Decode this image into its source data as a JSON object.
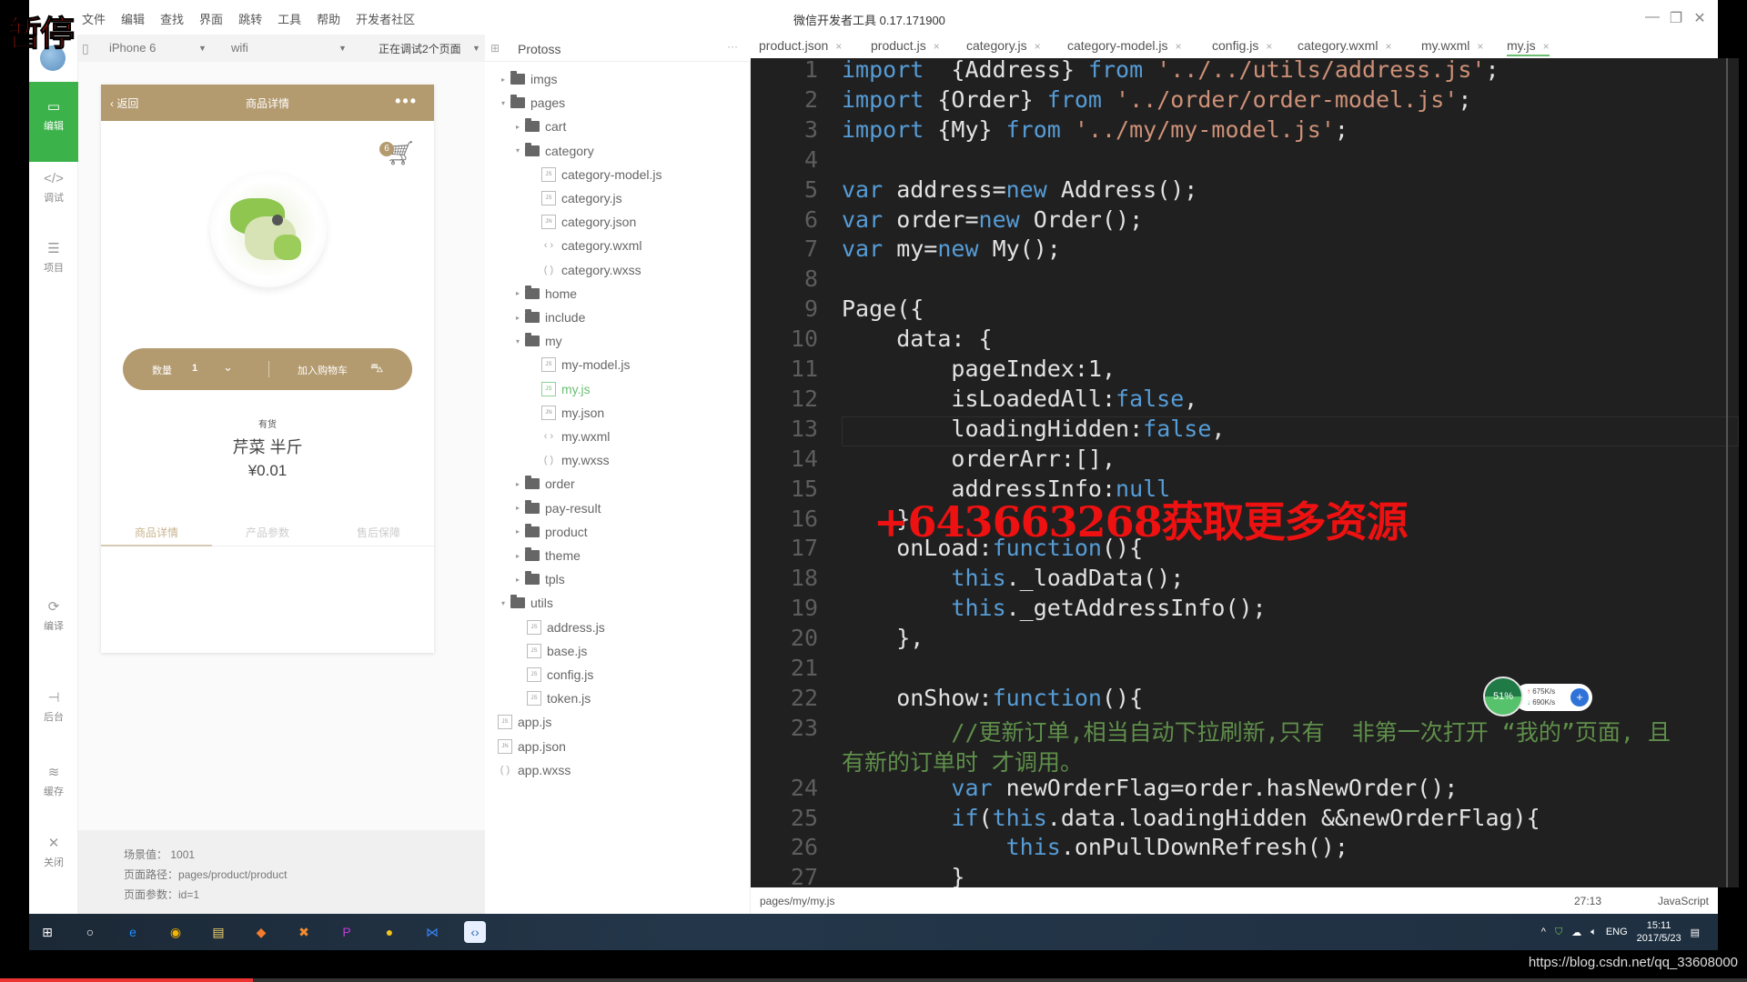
{
  "overlay": {
    "pause_label": "暂停",
    "watermark": "+643663268获取更多资源",
    "blog_url": "https://blog.csdn.net/qq_33608000",
    "video_progress": 0.145
  },
  "window": {
    "title": "微信开发者工具 0.17.171900",
    "menu": [
      "文件",
      "编辑",
      "查找",
      "界面",
      "跳转",
      "工具",
      "帮助",
      "开发者社区"
    ],
    "controls": {
      "minimize": "—",
      "maximize": "❐",
      "close": "✕"
    }
  },
  "sidebar": {
    "items": [
      {
        "label": "编辑",
        "icon": "editor-icon",
        "glyph": "▭",
        "active": true
      },
      {
        "label": "调试",
        "icon": "code-icon",
        "glyph": "</>"
      },
      {
        "label": "项目",
        "icon": "menu-icon",
        "glyph": "☰"
      },
      {
        "label": "编译",
        "icon": "compile-icon",
        "glyph": "⟳"
      },
      {
        "label": "后台",
        "icon": "backend-icon",
        "glyph": "⊣"
      },
      {
        "label": "缓存",
        "icon": "layers-icon",
        "glyph": "≋"
      },
      {
        "label": "关闭",
        "icon": "close-icon",
        "glyph": "✕"
      }
    ]
  },
  "simulator": {
    "device": "iPhone 6",
    "network": "wifi",
    "debug_status": "正在调试2个页面",
    "phone": {
      "nav_back": "返回",
      "nav_title": "商品详情",
      "nav_more": "•••",
      "cart_count": "6",
      "quantity_label": "数量",
      "quantity_value": "1",
      "add_cart_label": "加入购物车",
      "stock": "有货",
      "product_name": "芹菜 半斤",
      "price": "¥0.01",
      "tabs": [
        "商品详情",
        "产品参数",
        "售后保障"
      ]
    },
    "info": {
      "scene_label": "场景值：",
      "scene_value": "1001",
      "path_label": "页面路径：",
      "path_value": "pages/product/product",
      "params_label": "页面参数：",
      "params_value": "id=1"
    }
  },
  "filetree": {
    "project": "Protoss",
    "nodes": [
      {
        "name": "imgs",
        "type": "folder",
        "depth": 0,
        "open": false
      },
      {
        "name": "pages",
        "type": "folder",
        "depth": 0,
        "open": true
      },
      {
        "name": "cart",
        "type": "folder",
        "depth": 1,
        "open": false
      },
      {
        "name": "category",
        "type": "folder",
        "depth": 1,
        "open": true
      },
      {
        "name": "category-model.js",
        "type": "js",
        "depth": 2
      },
      {
        "name": "category.js",
        "type": "js",
        "depth": 2
      },
      {
        "name": "category.json",
        "type": "json",
        "depth": 2
      },
      {
        "name": "category.wxml",
        "type": "wxml",
        "depth": 2
      },
      {
        "name": "category.wxss",
        "type": "wxss",
        "depth": 2
      },
      {
        "name": "home",
        "type": "folder",
        "depth": 1,
        "open": false
      },
      {
        "name": "include",
        "type": "folder",
        "depth": 1,
        "open": false
      },
      {
        "name": "my",
        "type": "folder",
        "depth": 1,
        "open": true
      },
      {
        "name": "my-model.js",
        "type": "js",
        "depth": 2
      },
      {
        "name": "my.js",
        "type": "js",
        "depth": 2,
        "selected": true
      },
      {
        "name": "my.json",
        "type": "json",
        "depth": 2
      },
      {
        "name": "my.wxml",
        "type": "wxml",
        "depth": 2
      },
      {
        "name": "my.wxss",
        "type": "wxss",
        "depth": 2
      },
      {
        "name": "order",
        "type": "folder",
        "depth": 1,
        "open": false
      },
      {
        "name": "pay-result",
        "type": "folder",
        "depth": 1,
        "open": false
      },
      {
        "name": "product",
        "type": "folder",
        "depth": 1,
        "open": false
      },
      {
        "name": "theme",
        "type": "folder",
        "depth": 1,
        "open": false
      },
      {
        "name": "tpls",
        "type": "folder",
        "depth": 1,
        "open": false
      },
      {
        "name": "utils",
        "type": "folder",
        "depth": 0,
        "open": true
      },
      {
        "name": "address.js",
        "type": "js",
        "depth": 1
      },
      {
        "name": "base.js",
        "type": "js",
        "depth": 1
      },
      {
        "name": "config.js",
        "type": "js",
        "depth": 1
      },
      {
        "name": "token.js",
        "type": "js",
        "depth": 1
      },
      {
        "name": "app.js",
        "type": "js",
        "depth": 0,
        "root_file": true
      },
      {
        "name": "app.json",
        "type": "json",
        "depth": 0,
        "root_file": true
      },
      {
        "name": "app.wxss",
        "type": "wxss",
        "depth": 0,
        "root_file": true
      }
    ]
  },
  "editor": {
    "tabs": [
      {
        "label": "product.json"
      },
      {
        "label": "product.js"
      },
      {
        "label": "category.js"
      },
      {
        "label": "category-model.js"
      },
      {
        "label": "config.js"
      },
      {
        "label": "category.wxml"
      },
      {
        "label": "my.wxml"
      },
      {
        "label": "my.js",
        "active": true
      }
    ],
    "close_glyph": "×",
    "lines": [
      {
        "n": "1",
        "tokens": [
          [
            "kw",
            "import"
          ],
          [
            "",
            "  {Address} "
          ],
          [
            "kw",
            "from"
          ],
          [
            "str",
            " '../../utils/address.js'"
          ],
          [
            "",
            ";"
          ]
        ]
      },
      {
        "n": "2",
        "tokens": [
          [
            "kw",
            "import"
          ],
          [
            "",
            " {Order} "
          ],
          [
            "kw",
            "from"
          ],
          [
            "str",
            " '../order/order-model.js'"
          ],
          [
            "",
            ";"
          ]
        ]
      },
      {
        "n": "3",
        "tokens": [
          [
            "kw",
            "import"
          ],
          [
            "",
            " {My} "
          ],
          [
            "kw",
            "from"
          ],
          [
            "str",
            " '../my/my-model.js'"
          ],
          [
            "",
            ";"
          ]
        ]
      },
      {
        "n": "4",
        "tokens": []
      },
      {
        "n": "5",
        "tokens": [
          [
            "kw",
            "var"
          ],
          [
            "",
            " address="
          ],
          [
            "kw",
            "new"
          ],
          [
            "",
            " Address();"
          ]
        ]
      },
      {
        "n": "6",
        "tokens": [
          [
            "kw",
            "var"
          ],
          [
            "",
            " order="
          ],
          [
            "kw",
            "new"
          ],
          [
            "",
            " Order();"
          ]
        ]
      },
      {
        "n": "7",
        "tokens": [
          [
            "kw",
            "var"
          ],
          [
            "",
            " my="
          ],
          [
            "kw",
            "new"
          ],
          [
            "",
            " My();"
          ]
        ]
      },
      {
        "n": "8",
        "tokens": []
      },
      {
        "n": "9",
        "tokens": [
          [
            "",
            "Page({"
          ]
        ]
      },
      {
        "n": "10",
        "tokens": [
          [
            "",
            "    data: {"
          ]
        ]
      },
      {
        "n": "11",
        "tokens": [
          [
            "",
            "        pageIndex:1,"
          ]
        ]
      },
      {
        "n": "12",
        "tokens": [
          [
            "",
            "        isLoadedAll:"
          ],
          [
            "kw",
            "false"
          ],
          [
            "",
            ","
          ]
        ]
      },
      {
        "n": "13",
        "tokens": [
          [
            "",
            "        loadingHidden:"
          ],
          [
            "kw",
            "false"
          ],
          [
            "",
            ","
          ]
        ]
      },
      {
        "n": "14",
        "tokens": [
          [
            "",
            "        orderArr:[],"
          ]
        ]
      },
      {
        "n": "15",
        "tokens": [
          [
            "",
            "        addressInfo:"
          ],
          [
            "kw",
            "null"
          ]
        ]
      },
      {
        "n": "16",
        "tokens": [
          [
            "",
            "    },"
          ]
        ]
      },
      {
        "n": "17",
        "tokens": [
          [
            "",
            "    onLoad:"
          ],
          [
            "kw",
            "function"
          ],
          [
            "",
            "(){"
          ]
        ]
      },
      {
        "n": "18",
        "tokens": [
          [
            "kw",
            "        this"
          ],
          [
            "",
            "._loadData();"
          ]
        ]
      },
      {
        "n": "19",
        "tokens": [
          [
            "kw",
            "        this"
          ],
          [
            "",
            "._getAddressInfo();"
          ]
        ]
      },
      {
        "n": "20",
        "tokens": [
          [
            "",
            "    },"
          ]
        ]
      },
      {
        "n": "21",
        "tokens": []
      },
      {
        "n": "22",
        "tokens": [
          [
            "",
            "    onShow:"
          ],
          [
            "kw",
            "function"
          ],
          [
            "",
            "(){"
          ]
        ]
      },
      {
        "n": "23",
        "tokens": [
          [
            "cmt",
            "        //更新订单,相当自动下拉刷新,只有  非第一次打开 “我的”页面, 且"
          ]
        ]
      },
      {
        "n": "",
        "tokens": [
          [
            "cmt",
            "有新的订单时 才调用。"
          ]
        ]
      },
      {
        "n": "24",
        "tokens": [
          [
            "kw",
            "        var"
          ],
          [
            "",
            " newOrderFlag=order.hasNewOrder();"
          ]
        ]
      },
      {
        "n": "25",
        "tokens": [
          [
            "kw",
            "        if"
          ],
          [
            "",
            "("
          ],
          [
            "kw",
            "this"
          ],
          [
            "",
            ".data.loadingHidden &&newOrderFlag){"
          ]
        ]
      },
      {
        "n": "26",
        "tokens": [
          [
            "kw",
            "            this"
          ],
          [
            "",
            ".onPullDownRefresh();"
          ]
        ]
      },
      {
        "n": "27",
        "tokens": [
          [
            "",
            "        }"
          ]
        ]
      }
    ],
    "status_path": "pages/my/my.js",
    "cursor_pos": "27:13",
    "language": "JavaScript"
  },
  "netmon": {
    "percent": "51%",
    "upload": "675K/s",
    "download": "690K/s"
  },
  "taskbar": {
    "apps": [
      {
        "name": "windows-start-icon",
        "glyph": "⊞"
      },
      {
        "name": "search-circle-icon",
        "glyph": "○"
      },
      {
        "name": "edge-browser-icon",
        "glyph": "e"
      },
      {
        "name": "chrome-browser-icon",
        "glyph": "◉"
      },
      {
        "name": "file-explorer-icon",
        "glyph": "▤"
      },
      {
        "name": "app-icon-orange",
        "glyph": "◆"
      },
      {
        "name": "app-icon-x",
        "glyph": "✖"
      },
      {
        "name": "phpstorm-icon",
        "glyph": "P"
      },
      {
        "name": "app-icon-yellow",
        "glyph": "●"
      },
      {
        "name": "vscode-icon",
        "glyph": "⋈"
      },
      {
        "name": "wechat-devtools-icon",
        "glyph": "‹›",
        "active": true
      }
    ],
    "lang": "ENG",
    "time": "15:11",
    "date": "2017/5/23"
  }
}
